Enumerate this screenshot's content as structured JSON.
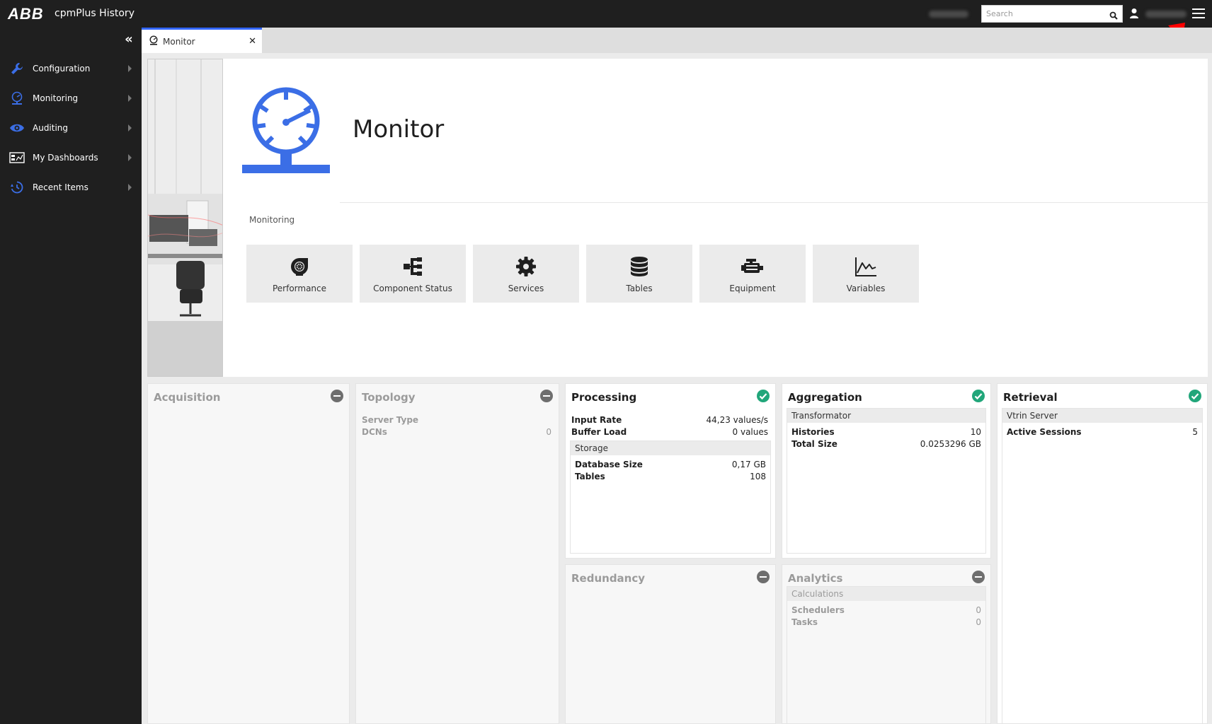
{
  "header": {
    "logo": "ABB",
    "app_title": "cpmPlus History",
    "search_placeholder": "Search"
  },
  "sidebar": {
    "collapse_label": "«",
    "items": [
      {
        "label": "Configuration",
        "icon": "wrench-icon"
      },
      {
        "label": "Monitoring",
        "icon": "monitor-gauge-icon"
      },
      {
        "label": "Auditing",
        "icon": "eye-icon"
      },
      {
        "label": "My Dashboards",
        "icon": "dashboard-icon"
      },
      {
        "label": "Recent Items",
        "icon": "recent-icon"
      }
    ]
  },
  "tabs": [
    {
      "label": "Monitor",
      "close": "✕"
    }
  ],
  "main": {
    "title": "Monitor",
    "section_label": "Monitoring",
    "tiles": [
      {
        "label": "Performance",
        "icon": "turbo-icon"
      },
      {
        "label": "Component Status",
        "icon": "hierarchy-icon"
      },
      {
        "label": "Services",
        "icon": "gear-icon"
      },
      {
        "label": "Tables",
        "icon": "database-icon"
      },
      {
        "label": "Equipment",
        "icon": "engine-icon"
      },
      {
        "label": "Variables",
        "icon": "line-chart-icon"
      }
    ]
  },
  "cards": {
    "acquisition": {
      "title": "Acquisition",
      "status": "inactive"
    },
    "topology": {
      "title": "Topology",
      "status": "inactive",
      "server_type_label": "Server Type",
      "dcns_label": "DCNs",
      "dcns_value": "0"
    },
    "processing": {
      "title": "Processing",
      "status": "ok",
      "input_rate_label": "Input Rate",
      "input_rate_value": "44,23 values/s",
      "buffer_load_label": "Buffer Load",
      "buffer_load_value": "0 values",
      "storage_head": "Storage",
      "db_size_label": "Database Size",
      "db_size_value": "0,17 GB",
      "tables_label": "Tables",
      "tables_value": "108"
    },
    "aggregation": {
      "title": "Aggregation",
      "status": "ok",
      "transformator_head": "Transformator",
      "histories_label": "Histories",
      "histories_value": "10",
      "total_size_label": "Total Size",
      "total_size_value": "0.0253296 GB"
    },
    "retrieval": {
      "title": "Retrieval",
      "status": "ok",
      "vtrin_head": "Vtrin Server",
      "sessions_label": "Active Sessions",
      "sessions_value": "5"
    },
    "redundancy": {
      "title": "Redundancy",
      "status": "inactive"
    },
    "analytics": {
      "title": "Analytics",
      "status": "inactive",
      "calculations_head": "Calculations",
      "schedulers_label": "Schedulers",
      "schedulers_value": "0",
      "tasks_label": "Tasks",
      "tasks_value": "0"
    }
  },
  "colors": {
    "accent_blue": "#3b6ee6",
    "status_ok": "#21a67a",
    "status_inactive": "#6e6e6e",
    "topbar_bg": "#1f1f1f",
    "annotation_arrow": "#ff0000"
  }
}
